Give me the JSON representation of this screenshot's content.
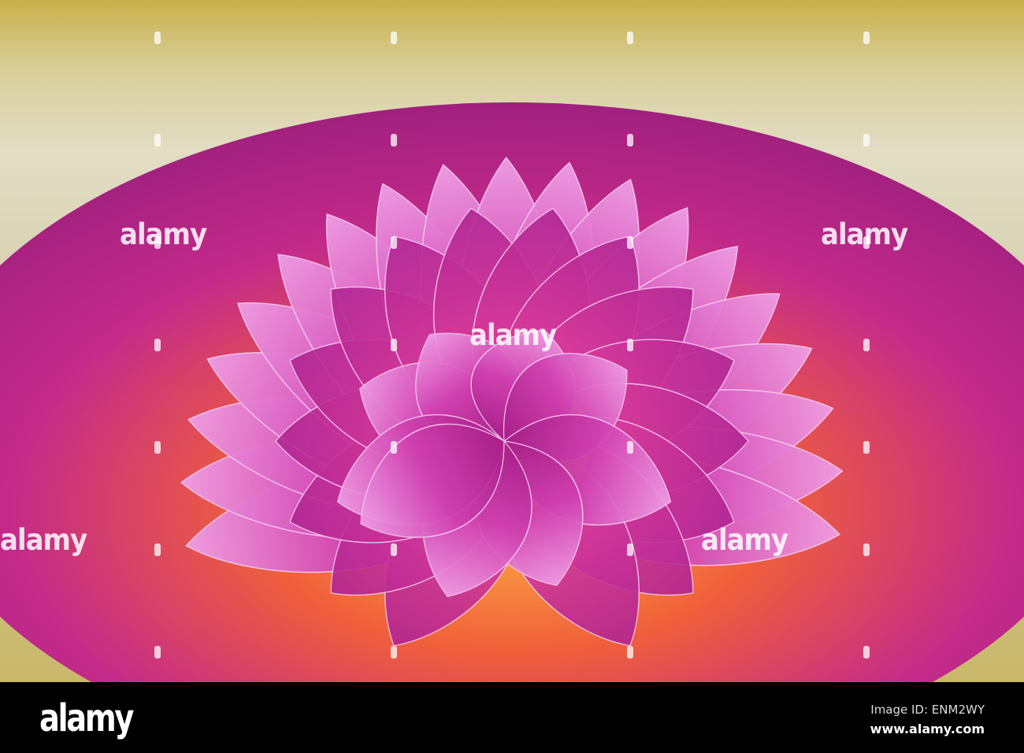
{
  "watermark": {
    "text": "alamy"
  },
  "footer": {
    "logo": "alamy",
    "image_id": "Image ID: ENM2WY",
    "website": "www.alamy.com"
  },
  "colors": {
    "petal": "#c0309a",
    "petal_light": "#e77fd6",
    "center": "#f2a23a",
    "background": "#ddd6b8"
  }
}
